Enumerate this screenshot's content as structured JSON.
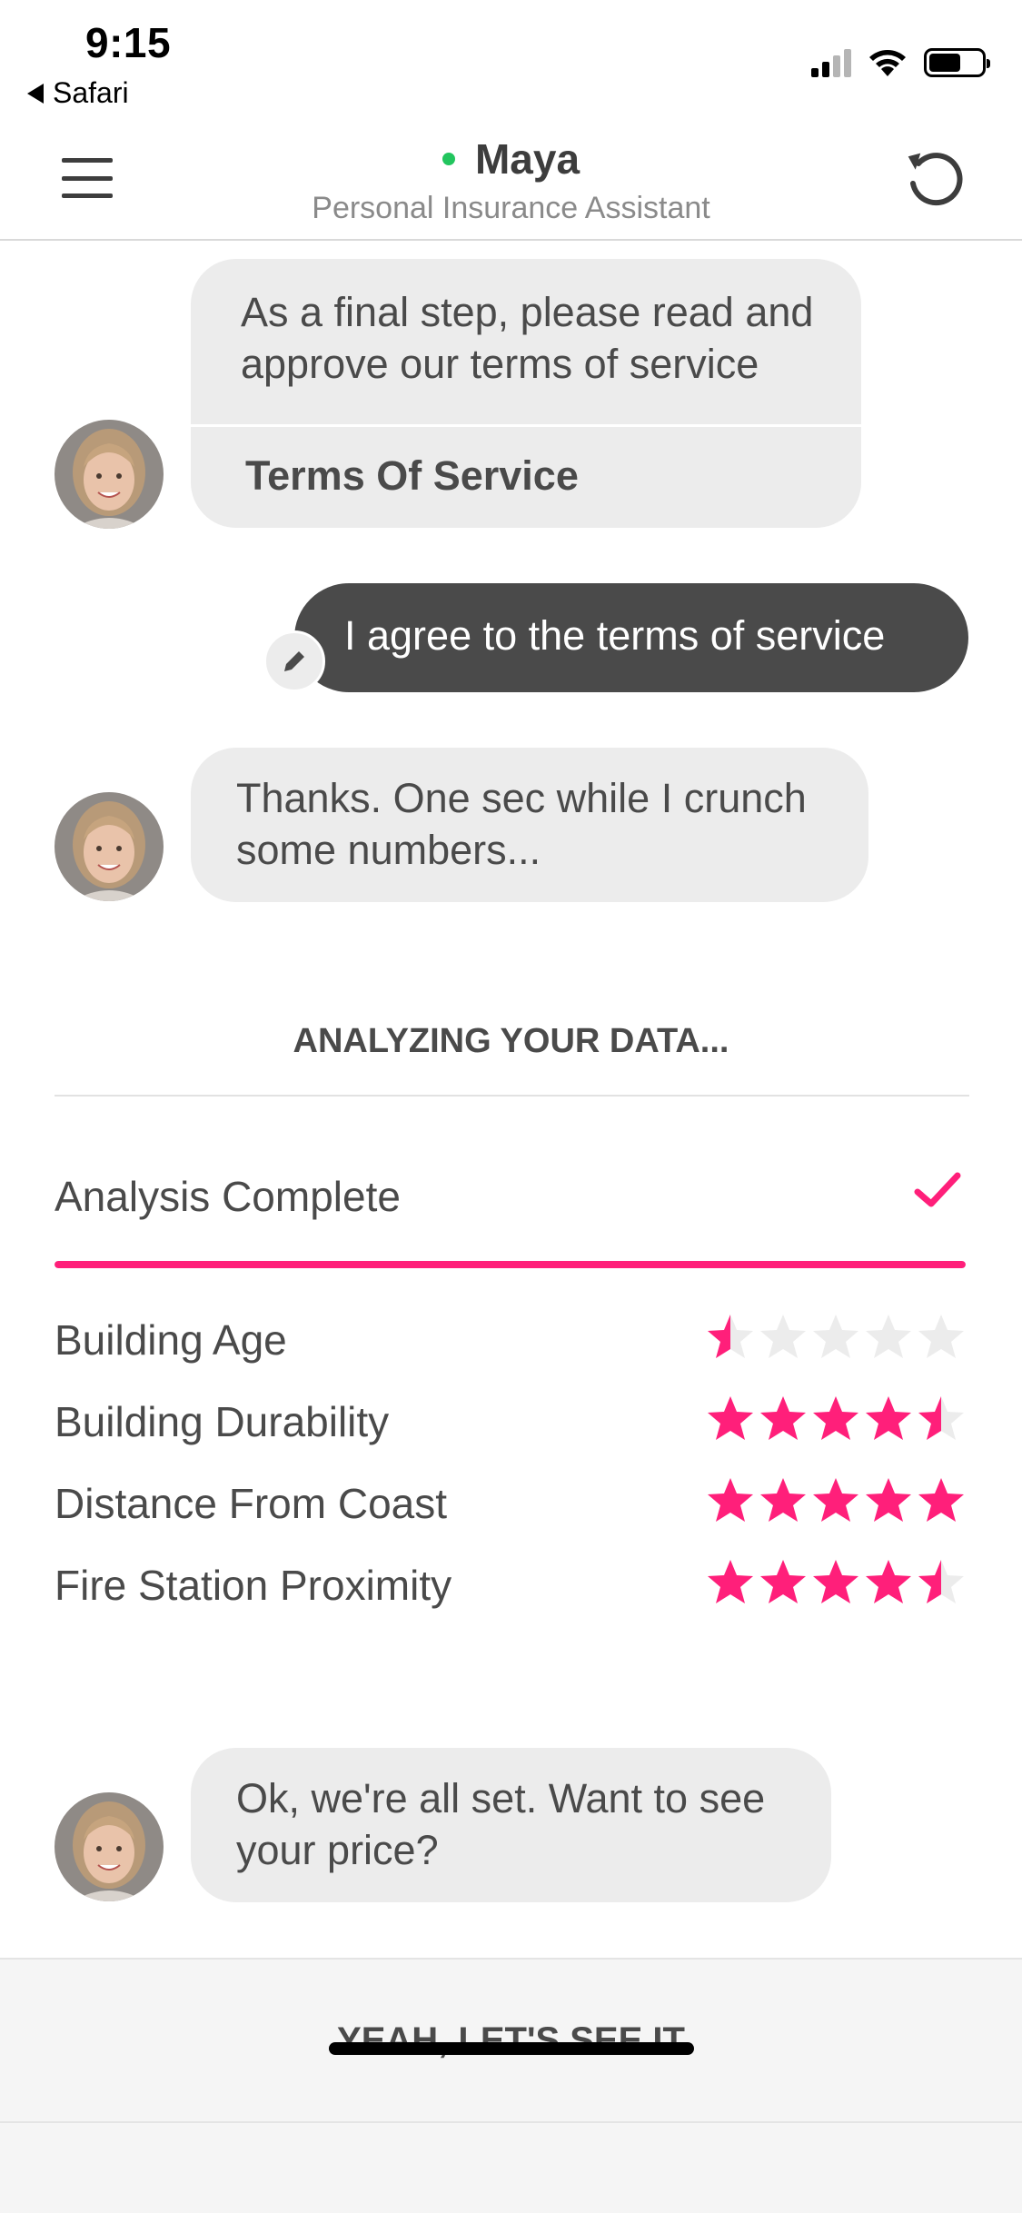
{
  "status_bar": {
    "time": "9:15",
    "back_label": "Safari",
    "battery_level": 0.6,
    "signal_bars_on": 2
  },
  "header": {
    "name": "Maya",
    "subtitle": "Personal Insurance Assistant",
    "menu_icon": "hamburger-menu-icon",
    "refresh_icon": "refresh-icon",
    "online_color": "#22c55e"
  },
  "chat": {
    "bot_message_1": "As a final step, please read and approve our terms of service",
    "tos_link": "Terms Of Service",
    "user_message_1": "I agree to the terms of service",
    "bot_message_2": "Thanks. One sec while I crunch some numbers...",
    "bot_message_3": "Ok, we're all set. Want to see your price?"
  },
  "analysis": {
    "title": "ANALYZING YOUR DATA...",
    "status": "Analysis Complete",
    "progress": 1.0,
    "accent_color": "#ff1f7a",
    "ratings": [
      {
        "label": "Building Age",
        "stars": 0.5
      },
      {
        "label": "Building Durability",
        "stars": 4.5
      },
      {
        "label": "Distance From Coast",
        "stars": 5
      },
      {
        "label": "Fire Station Proximity",
        "stars": 4.5
      }
    ],
    "max_stars": 5
  },
  "footer": {
    "cta_label": "YEAH, LET'S SEE IT"
  }
}
